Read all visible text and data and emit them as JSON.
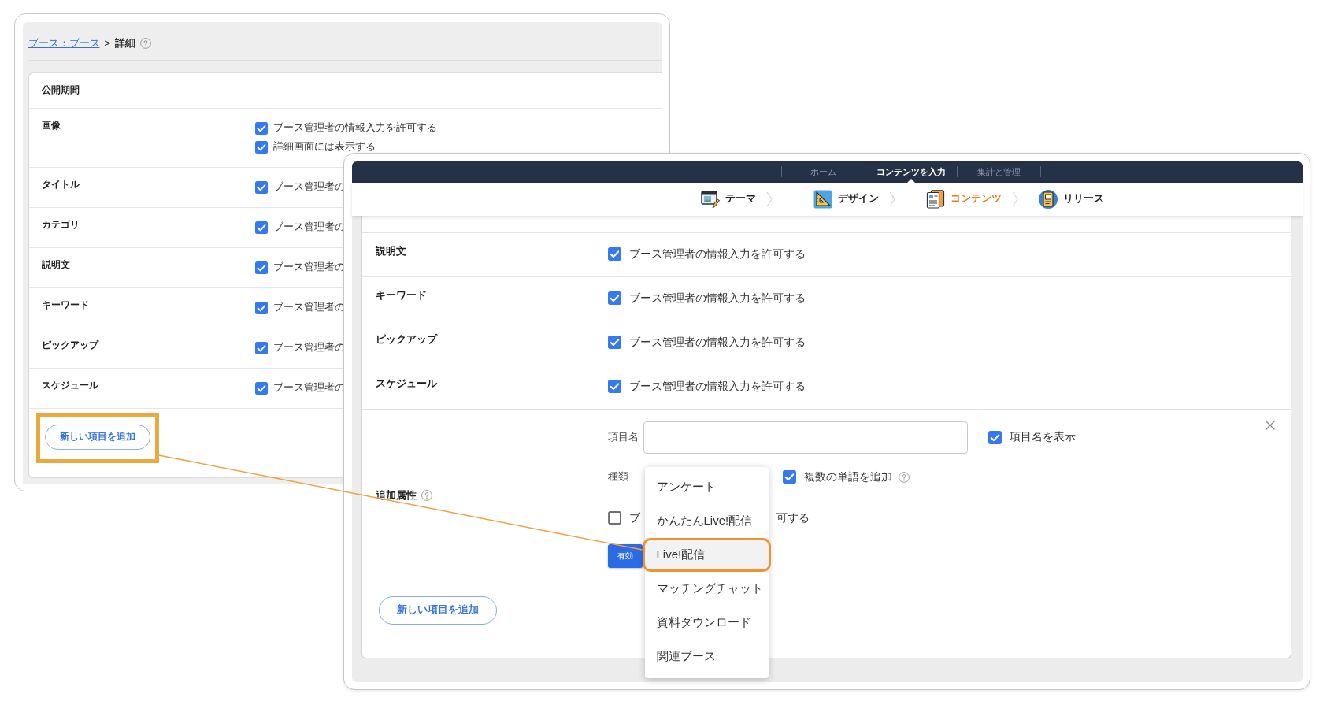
{
  "back_window": {
    "breadcrumb": {
      "link": "ブース：ブース",
      "separator": ">",
      "current": "詳細"
    },
    "rows": [
      {
        "label": "公開期間"
      },
      {
        "label": "画像",
        "options": [
          {
            "text": "ブース管理者の情報入力を許可する",
            "checked": true
          },
          {
            "text": "詳細画面には表示する",
            "checked": true
          }
        ]
      },
      {
        "label": "タイトル",
        "options": [
          {
            "text": "ブース管理者の",
            "checked": true
          }
        ]
      },
      {
        "label": "カテゴリ",
        "options": [
          {
            "text": "ブース管理者の",
            "checked": true
          }
        ]
      },
      {
        "label": "説明文",
        "options": [
          {
            "text": "ブース管理者の",
            "checked": true
          }
        ]
      },
      {
        "label": "キーワード",
        "options": [
          {
            "text": "ブース管理者の",
            "checked": true
          }
        ]
      },
      {
        "label": "ピックアップ",
        "options": [
          {
            "text": "ブース管理者の",
            "checked": true
          }
        ]
      },
      {
        "label": "スケジュール",
        "options": [
          {
            "text": "ブース管理者の",
            "checked": true
          }
        ]
      }
    ],
    "add_button": {
      "label": "新しい項目を追加",
      "highlighted": true
    }
  },
  "front_window": {
    "nav": [
      {
        "label": "ホーム",
        "selected": false
      },
      {
        "label": "コンテンツを入力",
        "selected": true
      },
      {
        "label": "集計と管理",
        "selected": false
      }
    ],
    "steps": [
      {
        "label": "テーマ",
        "selected": false
      },
      {
        "label": "デザイン",
        "selected": false
      },
      {
        "label": "コンテンツ",
        "selected": true
      },
      {
        "label": "リリース",
        "selected": false
      }
    ],
    "rows": [
      {
        "label": "説明文",
        "options": [
          {
            "text": "ブース管理者の情報入力を許可する",
            "checked": true
          }
        ]
      },
      {
        "label": "キーワード",
        "options": [
          {
            "text": "ブース管理者の情報入力を許可する",
            "checked": true
          }
        ]
      },
      {
        "label": "ピックアップ",
        "options": [
          {
            "text": "ブース管理者の情報入力を許可する",
            "checked": true
          }
        ]
      },
      {
        "label": "スケジュール",
        "options": [
          {
            "text": "ブース管理者の情報入力を許可する",
            "checked": true
          }
        ]
      }
    ],
    "extra_attribute": {
      "label": "追加属性",
      "name_label": "項目名",
      "show_name": {
        "text": "項目名を表示",
        "checked": true
      },
      "type_label": "種類",
      "multiple_words": {
        "text": "複数の単語を追加",
        "checked": true
      },
      "permission": {
        "checked": false,
        "text_before": "ブ",
        "text_after": "可する"
      },
      "enable_button": "有効"
    },
    "type_menu": [
      {
        "label": "アンケート",
        "selected": false,
        "highlighted": false
      },
      {
        "label": "かんたんLive!配信",
        "selected": false,
        "highlighted": false
      },
      {
        "label": "Live!配信",
        "selected": true,
        "highlighted": true
      },
      {
        "label": "マッチングチャット",
        "selected": false,
        "highlighted": false
      },
      {
        "label": "資料ダウンロード",
        "selected": false,
        "highlighted": false
      },
      {
        "label": "関連ブース",
        "selected": false,
        "highlighted": false
      }
    ],
    "add_button": {
      "label": "新しい項目を追加",
      "highlighted": false
    }
  }
}
